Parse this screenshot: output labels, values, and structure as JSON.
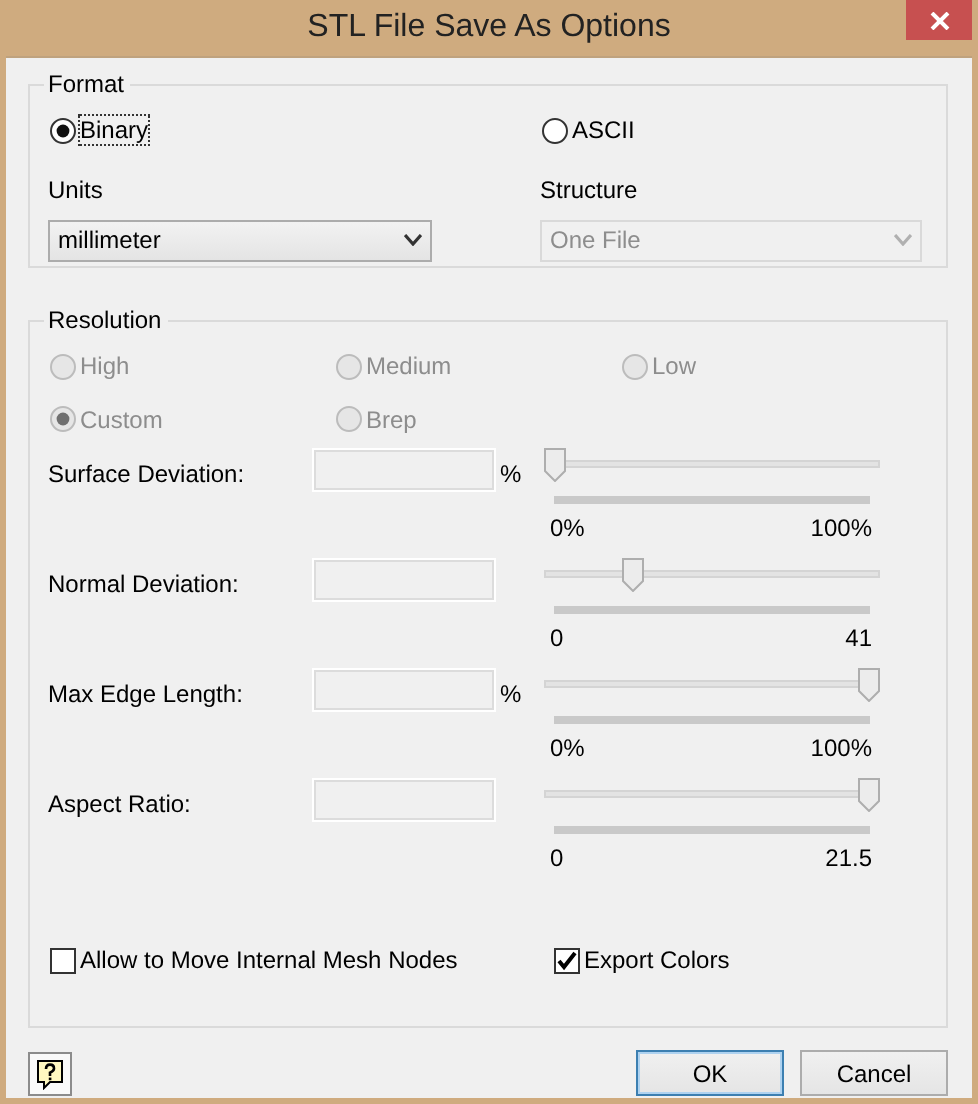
{
  "window": {
    "title": "STL File Save As Options"
  },
  "format": {
    "title": "Format",
    "options": [
      {
        "label": "Binary",
        "selected": true,
        "focused": true
      },
      {
        "label": "ASCII",
        "selected": false,
        "focused": false
      }
    ],
    "units": {
      "label": "Units",
      "value": "millimeter",
      "disabled": false
    },
    "structure": {
      "label": "Structure",
      "value": "One File",
      "disabled": true
    }
  },
  "resolution": {
    "title": "Resolution",
    "presets": [
      {
        "label": "High",
        "selected": false,
        "disabled": true
      },
      {
        "label": "Medium",
        "selected": false,
        "disabled": true
      },
      {
        "label": "Low",
        "selected": false,
        "disabled": true
      },
      {
        "label": "Custom",
        "selected": true,
        "disabled": true
      },
      {
        "label": "Brep",
        "selected": false,
        "disabled": true
      }
    ],
    "parameters": [
      {
        "label": "Surface Deviation:",
        "unit": "%",
        "disabled": true,
        "level": 0,
        "min": "0%",
        "max": "100%"
      },
      {
        "label": "Normal Deviation:",
        "disabled": true,
        "level": 0.25,
        "min": "0",
        "max": "41"
      },
      {
        "label": "Max Edge Length:",
        "unit": "%",
        "disabled": true,
        "level": 1,
        "min": "0%",
        "max": "100%"
      },
      {
        "label": "Aspect Ratio:",
        "disabled": true,
        "level": 1,
        "min": "0",
        "max": "21.5"
      }
    ],
    "options": [
      {
        "label": "Allow to Move Internal Mesh Nodes",
        "checked": false
      },
      {
        "label": "Export Colors",
        "checked": true
      }
    ]
  },
  "buttons": [
    {
      "label": "OK",
      "default": true
    },
    {
      "label": "Cancel",
      "default": false
    }
  ]
}
